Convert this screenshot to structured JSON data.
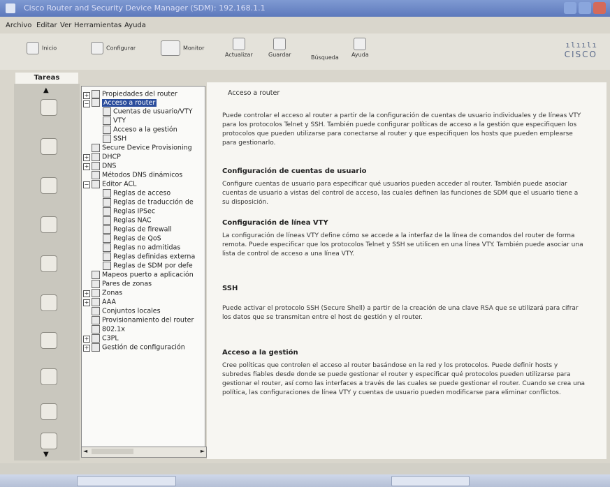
{
  "window": {
    "title": "Cisco Router and Security Device Manager (SDM): 192.168.1.1"
  },
  "menu": [
    "Archivo",
    "Editar",
    "Ver",
    "Herramientas",
    "Ayuda"
  ],
  "toolbar": {
    "inicio": "Inicio",
    "configurar": "Configurar",
    "monitor": "Monitor",
    "actualizar": "Actualizar",
    "guardar": "Guardar",
    "buscar": "Búsqueda",
    "ayuda": "Ayuda",
    "brand": "CISCO",
    "brand_bars": "ılıılı"
  },
  "tasks_label": "Tareas",
  "tree": {
    "items": [
      "Propiedades del router",
      "Acceso a router",
      "Cuentas de usuario/VTY",
      "VTY",
      "Acceso a la gestión",
      "SSH",
      "Secure Device Provisioning",
      "DHCP",
      "DNS",
      "Métodos DNS dinámicos",
      "Editor ACL",
      "Reglas de acceso",
      "Reglas de traducción de",
      "Reglas IPSec",
      "Reglas NAC",
      "Reglas de firewall",
      "Reglas de QoS",
      "Reglas no admitidas",
      "Reglas definidas externa",
      "Reglas de SDM por defe",
      "Mapeos puerto a aplicación",
      "Pares de zonas",
      "Zonas",
      "AAA",
      "Conjuntos locales",
      "Provisionamiento del router",
      "802.1x",
      "C3PL",
      "Gestión de configuración"
    ]
  },
  "content": {
    "top_title": "Acceso a router",
    "intro": "Puede controlar el acceso al router a partir de la configuración de cuentas de usuario individuales y de líneas VTY para los protocolos Telnet y SSH. También puede configurar políticas de acceso a la gestión que especifiquen los protocolos que pueden utilizarse para conectarse al router y que especifiquen los hosts que pueden emplearse para gestionarlo.",
    "sections": [
      {
        "heading": "Configuración de cuentas de usuario",
        "text": "Configure cuentas de usuario para especificar qué usuarios pueden acceder al router. También puede asociar cuentas de usuario a vistas del control de acceso, las cuales definen las funciones de SDM que el usuario tiene a su disposición."
      },
      {
        "heading": "Configuración de línea VTY",
        "text": "La configuración de líneas VTY define cómo se accede a la interfaz de la línea de comandos del router de forma remota. Puede especificar que los protocolos Telnet y SSH se utilicen en una línea VTY. También puede asociar una lista de control de acceso a una línea VTY."
      },
      {
        "heading": "SSH",
        "text": "Puede activar el protocolo SSH (Secure Shell) a partir de la creación de una clave RSA que se utilizará para cifrar los datos que se transmitan entre el host de gestión y el router."
      },
      {
        "heading": "Acceso a la gestión",
        "text": "Cree políticas que controlen el acceso al router basándose en la red y los protocolos. Puede definir hosts y subredes fiables desde donde se puede gestionar el router y especificar qué protocolos pueden utilizarse para gestionar el router, así como las interfaces a través de las cuales se puede gestionar el router. Cuando se crea una política, las configuraciones de línea VTY y cuentas de usuario pueden modificarse para eliminar conflictos."
      }
    ]
  }
}
